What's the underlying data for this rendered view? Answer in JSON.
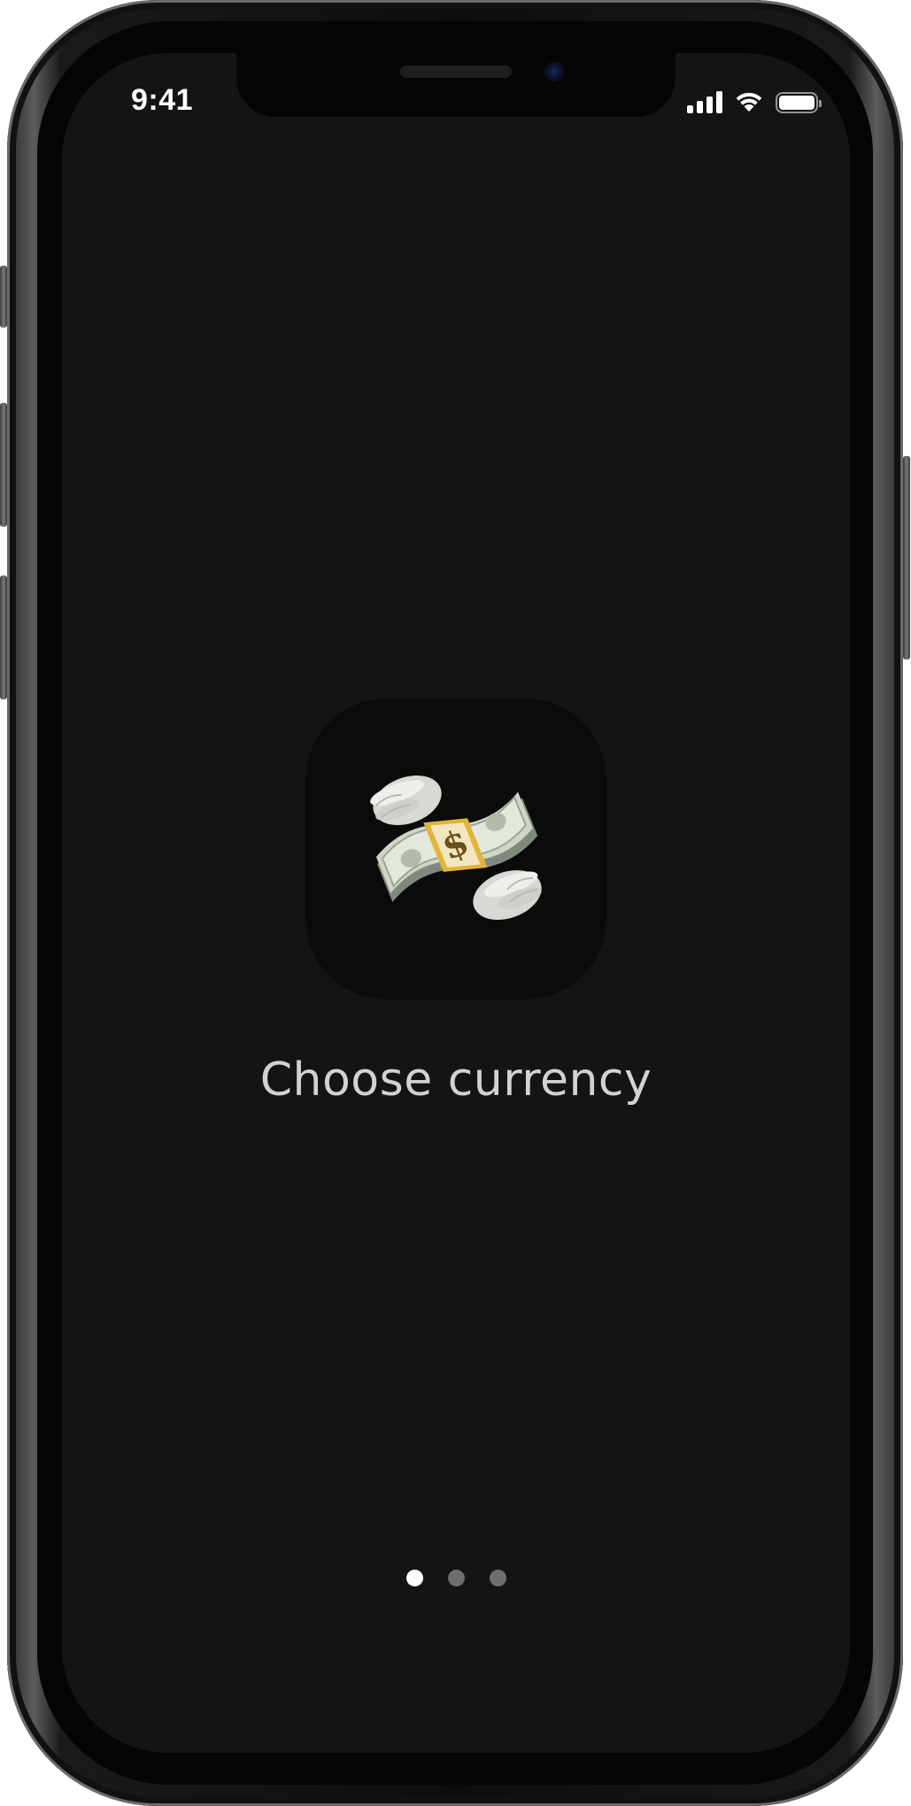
{
  "status_bar": {
    "time": "9:41",
    "battery_level": 1.0,
    "signal_bars": 4,
    "wifi": true
  },
  "onboarding": {
    "icon": "money-with-wings-icon",
    "title": "Choose currency",
    "page_count": 3,
    "active_page": 1
  },
  "colors": {
    "screen_background": "#141414",
    "icon_tile": "#0b0b0b",
    "title_text": "#d2d2d2",
    "dot_active": "#ffffff",
    "dot_inactive": "#6e6e6e"
  }
}
